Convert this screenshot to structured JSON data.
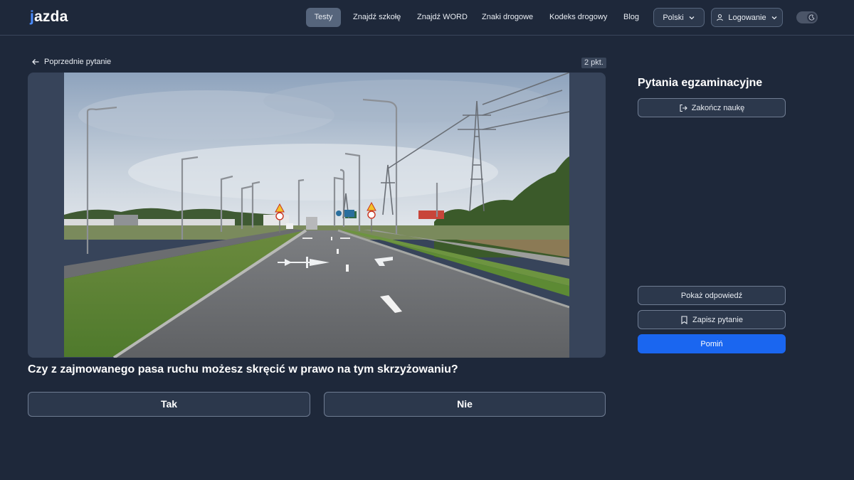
{
  "brand": {
    "logo_text": "jazda"
  },
  "nav": {
    "items": [
      {
        "label": "Testy",
        "active": true
      },
      {
        "label": "Znajdź szkołę"
      },
      {
        "label": "Znajdź WORD"
      },
      {
        "label": "Znaki drogowe"
      },
      {
        "label": "Kodeks drogowy"
      },
      {
        "label": "Blog"
      }
    ],
    "language": "Polski",
    "login": "Logowanie",
    "theme_toggle_icon": "moon-icon"
  },
  "question": {
    "back_label": "Poprzednie pytanie",
    "points": "2 pkt.",
    "text": "Czy z zajmowanego pasa ruchu możesz skręcić w prawo na tym skrzyżowaniu?",
    "answers": [
      "Tak",
      "Nie"
    ]
  },
  "sidebar": {
    "title": "Pytania egzaminacyjne",
    "finish_label": "Zakończ naukę",
    "show_answer_label": "Pokaż odpowiedź",
    "save_label": "Zapisz pytanie",
    "skip_label": "Pomiń"
  },
  "colors": {
    "background": "#1e283a",
    "accent": "#1a66f0",
    "button_bg": "#2c384c",
    "border": "#6f7c92"
  }
}
